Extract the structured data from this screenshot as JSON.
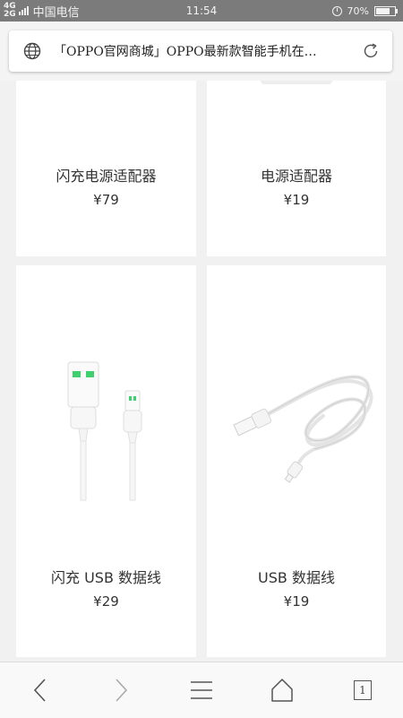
{
  "status_bar": {
    "network": "4G",
    "network2": "2G",
    "carrier": "中国电信",
    "time": "11:54",
    "battery": "70%",
    "alarm_icon": "alarm-icon",
    "battery_icon": "battery-icon"
  },
  "browser": {
    "page_title": "「OPPO官网商城」OPPO最新款智能手机在…",
    "globe_icon": "globe-icon",
    "refresh_icon": "refresh-icon"
  },
  "products": [
    {
      "name": "闪充电源适配器",
      "price": "¥79"
    },
    {
      "name": "电源适配器",
      "price": "¥19"
    },
    {
      "name": "闪充 USB 数据线",
      "price": "¥29"
    },
    {
      "name": "USB 数据线",
      "price": "¥19"
    }
  ],
  "bottom_nav": {
    "back_icon": "back-icon",
    "forward_icon": "forward-icon",
    "menu_icon": "menu-icon",
    "home_icon": "home-icon",
    "tab_count": "1"
  },
  "colors": {
    "status_bar": "#7b7b7b",
    "page_background": "#f1f1f1",
    "card": "#ffffff",
    "cable_accent": "#3ecf6e"
  }
}
